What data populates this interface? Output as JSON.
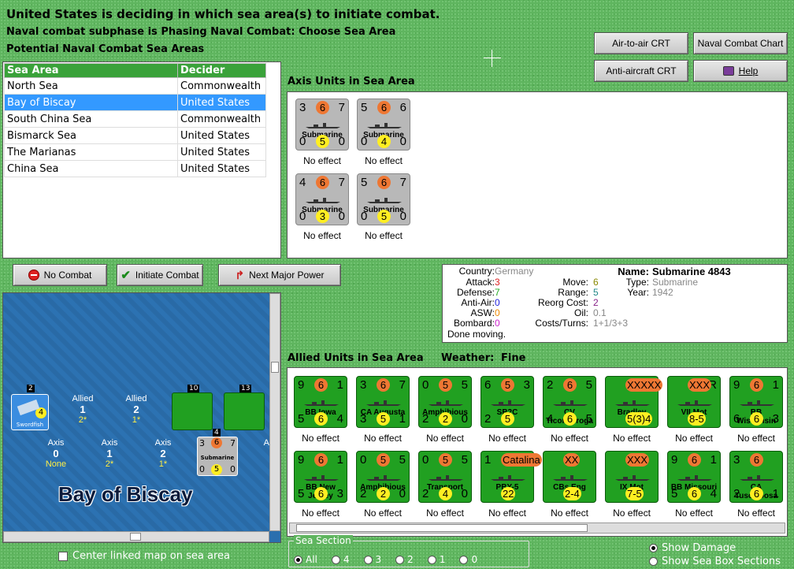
{
  "header": {
    "line1": "United States is deciding in which sea area(s) to initiate combat.",
    "line2": "Naval combat subphase is Phasing Naval Combat: Choose Sea Area",
    "line3": "Potential Naval Combat Sea Areas"
  },
  "crt_buttons": {
    "air_to_air": "Air-to-air CRT",
    "naval_chart": "Naval Combat Chart",
    "anti_aircraft": "Anti-aircraft CRT",
    "help": "Help"
  },
  "sea_table": {
    "col1": "Sea Area",
    "col2": "Decider",
    "rows": [
      {
        "area": "North Sea",
        "decider": "Commonwealth"
      },
      {
        "area": "Bay of Biscay",
        "decider": "United States"
      },
      {
        "area": "South China Sea",
        "decider": "Commonwealth"
      },
      {
        "area": "Bismarck Sea",
        "decider": "United States"
      },
      {
        "area": "The Marianas",
        "decider": "United States"
      },
      {
        "area": "China Sea",
        "decider": "United States"
      }
    ]
  },
  "axis_units": {
    "title": "Axis Units in Sea Area",
    "units": [
      {
        "tl": "3",
        "tm": "6",
        "tr": "7",
        "name": "Submarine",
        "bl": "0",
        "bm": "5",
        "br": "0",
        "effect": "No effect"
      },
      {
        "tl": "5",
        "tm": "6",
        "tr": "6",
        "name": "Submarine",
        "bl": "0",
        "bm": "4",
        "br": "0",
        "effect": "No effect"
      },
      {
        "tl": "4",
        "tm": "6",
        "tr": "7",
        "name": "Submarine",
        "bl": "0",
        "bm": "3",
        "br": "0",
        "effect": "No effect"
      },
      {
        "tl": "5",
        "tm": "6",
        "tr": "7",
        "name": "Submarine",
        "bl": "0",
        "bm": "5",
        "br": "0",
        "effect": "No effect"
      }
    ]
  },
  "action_buttons": {
    "no_combat": "No Combat",
    "initiate": "Initiate Combat",
    "next_major": "Next Major Power"
  },
  "info": {
    "country_lbl": "Country:",
    "country": "Germany",
    "attack_lbl": "Attack:",
    "attack": "3",
    "defense_lbl": "Defense:",
    "defense": "7",
    "antiair_lbl": "Anti-Air:",
    "antiair": "0",
    "asw_lbl": "ASW:",
    "asw": "0",
    "bombard_lbl": "Bombard:",
    "bombard": "0",
    "move_lbl": "Move:",
    "move": "6",
    "range_lbl": "Range:",
    "range": "5",
    "reorg_lbl": "Reorg Cost:",
    "reorg": "2",
    "oil_lbl": "Oil:",
    "oil": "0.1",
    "costs_lbl": "Costs/Turns:",
    "costs": "1+1/3+3",
    "name_lbl": "Name:",
    "name": "Submarine 4843",
    "type_lbl": "Type:",
    "type": "Submarine",
    "year_lbl": "Year:",
    "year": "1942",
    "status": "Done moving."
  },
  "allied": {
    "title": "Allied Units in Sea Area",
    "weather_lbl": "Weather:",
    "weather": "Fine",
    "row1": [
      {
        "tl": "9",
        "tm": "6",
        "tr": "1",
        "name": "BB Iowa",
        "bl": "5",
        "bm": "6",
        "br": "4",
        "effect": "No effect"
      },
      {
        "tl": "3",
        "tm": "6",
        "tr": "7",
        "name": "CA Augusta",
        "bl": "3",
        "bm": "5",
        "br": "1",
        "effect": "No effect"
      },
      {
        "tl": "0",
        "tm": "5",
        "tr": "5",
        "name": "Amphibious",
        "bl": "2",
        "bm": "2",
        "br": "0",
        "effect": "No effect"
      },
      {
        "tl": "6",
        "tm": "5",
        "tr": "3",
        "name": "SB2C",
        "bl": "2",
        "bm": "5",
        "br": "",
        "effect": "No effect"
      },
      {
        "tl": "2",
        "tm": "6",
        "tr": "5",
        "name": "CV Ticonderoga",
        "bl": "4",
        "bm": "6",
        "br": "5",
        "effect": "No effect"
      },
      {
        "tl": "",
        "tm": "XXXXX",
        "tr": "",
        "name": "Bradley",
        "bl": "",
        "bm": "5(3)4",
        "br": "",
        "effect": "No effect"
      },
      {
        "tl": "",
        "tm": "XXX",
        "tr": "R",
        "name": "VII Mot",
        "bl": "",
        "bm": "8-5",
        "br": "",
        "effect": "No effect"
      },
      {
        "tl": "9",
        "tm": "6",
        "tr": "1",
        "name": "BB Wisconsin",
        "bl": "6",
        "bm": "6",
        "br": "3",
        "effect": "No effect"
      }
    ],
    "row2": [
      {
        "tl": "9",
        "tm": "6",
        "tr": "1",
        "name": "BB New Jersey",
        "bl": "5",
        "bm": "6",
        "br": "3",
        "effect": "No effect"
      },
      {
        "tl": "0",
        "tm": "5",
        "tr": "5",
        "name": "Amphibious",
        "bl": "2",
        "bm": "2",
        "br": "0",
        "effect": "No effect"
      },
      {
        "tl": "0",
        "tm": "5",
        "tr": "5",
        "name": "Transport",
        "bl": "2",
        "bm": "4",
        "br": "0",
        "effect": "No effect"
      },
      {
        "tl": "1",
        "tm": "Catalina",
        "tr": "2",
        "name": "PBY-5",
        "bl": "",
        "bm": "22",
        "br": "",
        "effect": "No effect"
      },
      {
        "tl": "",
        "tm": "XX",
        "tr": "",
        "name": "CBs Eng",
        "bl": "",
        "bm": "2-4",
        "br": "",
        "effect": "No effect"
      },
      {
        "tl": "",
        "tm": "XXX",
        "tr": "",
        "name": "IX Mot",
        "bl": "",
        "bm": "7-5",
        "br": "",
        "effect": "No effect"
      },
      {
        "tl": "9",
        "tm": "6",
        "tr": "1",
        "name": "BB Missouri",
        "bl": "5",
        "bm": "6",
        "br": "4",
        "effect": "No effect"
      },
      {
        "tl": "3",
        "tm": "6",
        "tr": "",
        "name": "CA Tuscaloosa",
        "bl": "2",
        "bm": "6",
        "br": "1",
        "effect": "No effect"
      }
    ]
  },
  "map": {
    "title": "Bay of Biscay",
    "allied_lbl": "Allied",
    "axis_lbl": "Axis",
    "allied_boxes": [
      {
        "n": "1",
        "s": "2*"
      },
      {
        "n": "2",
        "s": "1*"
      }
    ],
    "axis_boxes": [
      {
        "n": "0",
        "s": "None"
      },
      {
        "n": "1",
        "s": "2*"
      },
      {
        "n": "2",
        "s": "1*"
      },
      {
        "n": "",
        "s": ""
      }
    ],
    "swordfish": "Swordfish",
    "swordfish_count": "2",
    "bb_missouri_count": "10",
    "bb_iowa_count": "13",
    "sub_count": "4",
    "map_sub": {
      "tl": "3",
      "tm": "6",
      "tr": "7",
      "name": "Submarine",
      "bl": "0",
      "bm": "5",
      "br": "0"
    }
  },
  "center_map_lbl": "Center linked map on sea area",
  "sea_section": {
    "legend": "Sea Section",
    "options": [
      "All",
      "4",
      "3",
      "2",
      "1",
      "0"
    ]
  },
  "show_damage": "Show Damage",
  "show_sea_box": "Show Sea Box Sections"
}
